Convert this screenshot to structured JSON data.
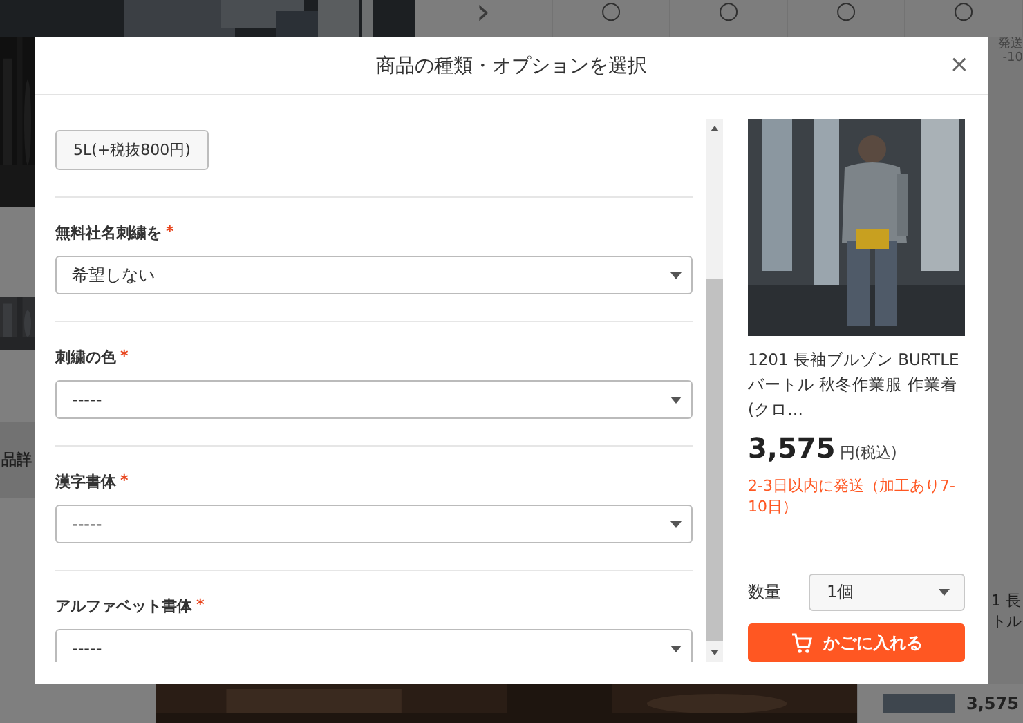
{
  "background": {
    "top_arrow": "›",
    "top_marks": [
      "○",
      "○",
      "○",
      "○"
    ],
    "top_right_lines": [
      "発送",
      "-10"
    ],
    "section_heading": "品詳",
    "side_lines": [
      "1 長",
      "トル"
    ],
    "side_price": "3,575"
  },
  "dialog": {
    "title": "商品の種類・オプションを選択",
    "close": "×",
    "option_chip": {
      "label": "5L(+税抜800円)"
    },
    "fields": [
      {
        "label": "無料社名刺繍を",
        "required_mark": "*",
        "value": "希望しない"
      },
      {
        "label": "刺繍の色",
        "required_mark": "*",
        "value": "-----"
      },
      {
        "label": "漢字書体",
        "required_mark": "*",
        "value": "-----"
      },
      {
        "label": "アルファベット書体",
        "required_mark": "*",
        "value": "-----"
      }
    ],
    "product": {
      "name": "1201 長袖ブルゾン BURTLE バートル 秋冬作業服 作業着 (クロ…",
      "price": "3,575",
      "price_unit": "円(税込)",
      "shipping": "2-3日以内に発送（加工あり7-10日）",
      "quantity_label": "数量",
      "quantity": "1個",
      "cart_button": "かごに入れる"
    }
  }
}
